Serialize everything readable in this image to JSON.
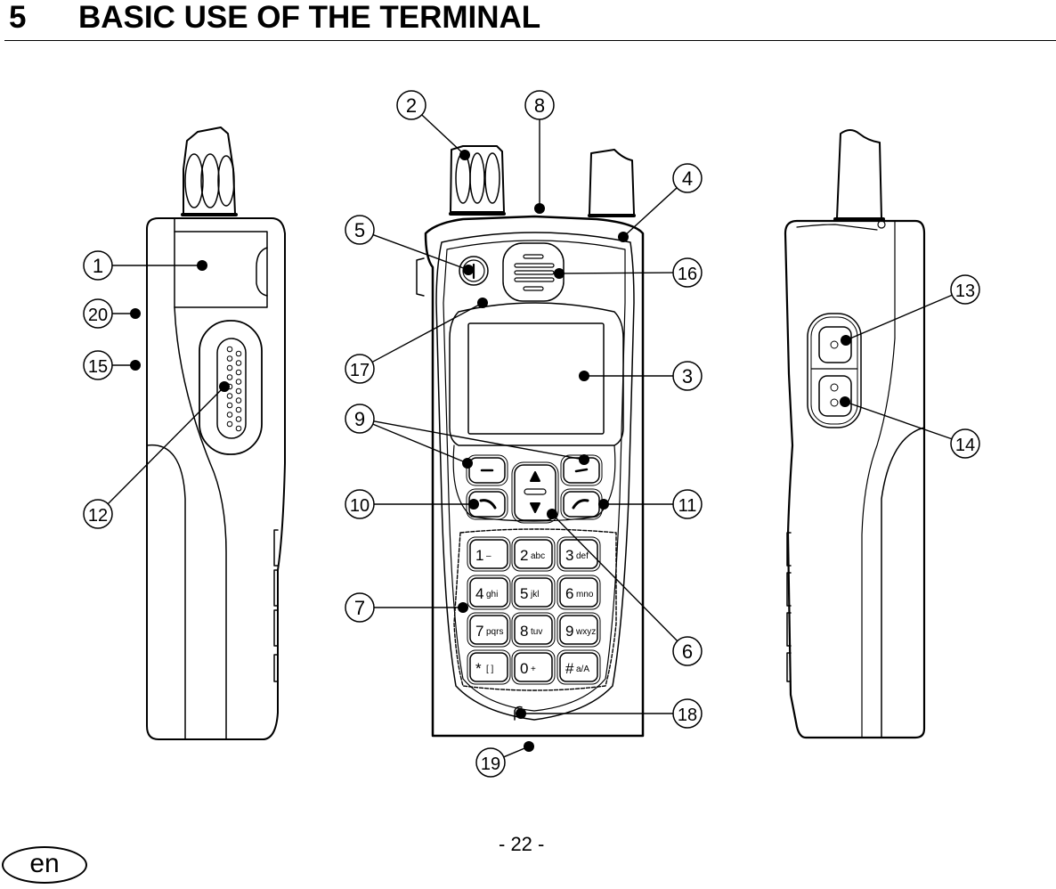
{
  "section": {
    "number": "5",
    "title": "BASIC USE OF THE TERMINAL"
  },
  "figure": {
    "views": [
      "left-side-view",
      "front-view",
      "right-side-view"
    ],
    "keypad": {
      "soft_key": "–",
      "nav_up": "▲",
      "nav_down": "▼",
      "keys": [
        {
          "main": "1",
          "sub": "–"
        },
        {
          "main": "2",
          "sub": "abc"
        },
        {
          "main": "3",
          "sub": "def"
        },
        {
          "main": "4",
          "sub": "ghi"
        },
        {
          "main": "5",
          "sub": "jkl"
        },
        {
          "main": "6",
          "sub": "mno"
        },
        {
          "main": "7",
          "sub": "pqrs"
        },
        {
          "main": "8",
          "sub": "tuv"
        },
        {
          "main": "9",
          "sub": "wxyz"
        },
        {
          "main": "*",
          "sub": "[ ]"
        },
        {
          "main": "0",
          "sub": "+"
        },
        {
          "main": "#",
          "sub": "a/A"
        }
      ]
    },
    "callouts": [
      {
        "label": "1",
        "view": "left"
      },
      {
        "label": "2",
        "view": "front"
      },
      {
        "label": "3",
        "view": "front"
      },
      {
        "label": "4",
        "view": "front"
      },
      {
        "label": "5",
        "view": "front"
      },
      {
        "label": "6",
        "view": "front"
      },
      {
        "label": "7",
        "view": "front"
      },
      {
        "label": "8",
        "view": "front"
      },
      {
        "label": "9",
        "view": "front"
      },
      {
        "label": "10",
        "view": "front"
      },
      {
        "label": "11",
        "view": "front"
      },
      {
        "label": "12",
        "view": "left"
      },
      {
        "label": "13",
        "view": "right"
      },
      {
        "label": "14",
        "view": "right"
      },
      {
        "label": "15",
        "view": "left"
      },
      {
        "label": "16",
        "view": "front"
      },
      {
        "label": "17",
        "view": "front"
      },
      {
        "label": "18",
        "view": "front"
      },
      {
        "label": "19",
        "view": "front"
      },
      {
        "label": "20",
        "view": "left"
      }
    ]
  },
  "footer": {
    "page": "- 22 -",
    "language": "en"
  }
}
